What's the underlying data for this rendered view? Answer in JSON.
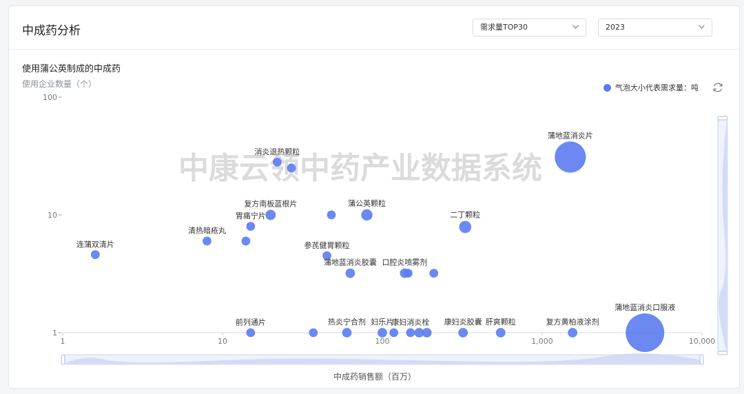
{
  "page": {
    "title": "中成药分析",
    "metric_select": "需求量TOP30",
    "year_select": "2023",
    "watermark": "中康云领中药产业数据系统"
  },
  "chart_data": {
    "type": "scatter",
    "title": "使用蒲公英制成的中成药",
    "xlabel": "中成药销售额（百万）",
    "ylabel": "使用企业数量（个）",
    "x_scale": "log",
    "y_scale": "log",
    "xlim": [
      1,
      10000
    ],
    "ylim": [
      1,
      100
    ],
    "x_ticks": [
      "1",
      "10",
      "100",
      "1,000",
      "10,000"
    ],
    "y_ticks": [
      "1",
      "10",
      "100"
    ],
    "legend": {
      "label": "气泡大小代表需求量：吨",
      "placement": "top-right"
    },
    "color": "#5b7cf0",
    "points": [
      {
        "x": 1.6,
        "y": 4.6,
        "size": 1,
        "label": "连蒲双清片"
      },
      {
        "x": 8,
        "y": 6,
        "size": 1,
        "label": "清热暗疮丸"
      },
      {
        "x": 14,
        "y": 6,
        "size": 1,
        "label": ""
      },
      {
        "x": 15,
        "y": 1,
        "size": 1,
        "label": "前列通片"
      },
      {
        "x": 15,
        "y": 8,
        "size": 1,
        "label": "胃痛宁片"
      },
      {
        "x": 20,
        "y": 10,
        "size": 2,
        "label": "复方南板蓝根片"
      },
      {
        "x": 22,
        "y": 28,
        "size": 1,
        "label": "消炎退热颗粒"
      },
      {
        "x": 27,
        "y": 25,
        "size": 1,
        "label": ""
      },
      {
        "x": 37,
        "y": 1,
        "size": 1,
        "label": ""
      },
      {
        "x": 45,
        "y": 4.5,
        "size": 1,
        "label": "参芪健胃颗粒"
      },
      {
        "x": 48,
        "y": 10,
        "size": 1,
        "label": ""
      },
      {
        "x": 60,
        "y": 1,
        "size": 1.5,
        "label": "热炎宁合剂"
      },
      {
        "x": 63,
        "y": 3.2,
        "size": 1.5,
        "label": "蒲地蓝消炎胶囊"
      },
      {
        "x": 80,
        "y": 10,
        "size": 3,
        "label": "蒲公英颗粒"
      },
      {
        "x": 100,
        "y": 1,
        "size": 1.5,
        "label": "妇乐片"
      },
      {
        "x": 118,
        "y": 1,
        "size": 1,
        "label": ""
      },
      {
        "x": 138,
        "y": 3.2,
        "size": 1.5,
        "label": "口腔炎喷雾剂"
      },
      {
        "x": 145,
        "y": 3.2,
        "size": 1,
        "label": ""
      },
      {
        "x": 150,
        "y": 1,
        "size": 1,
        "label": "康妇消炎栓"
      },
      {
        "x": 170,
        "y": 1,
        "size": 1.5,
        "label": ""
      },
      {
        "x": 190,
        "y": 1,
        "size": 1.5,
        "label": ""
      },
      {
        "x": 210,
        "y": 3.2,
        "size": 1,
        "label": ""
      },
      {
        "x": 330,
        "y": 7.9,
        "size": 4,
        "label": "二丁颗粒"
      },
      {
        "x": 320,
        "y": 1,
        "size": 1.5,
        "label": "康妇炎胶囊"
      },
      {
        "x": 550,
        "y": 1,
        "size": 1.5,
        "label": "肝爽颗粒"
      },
      {
        "x": 1550,
        "y": 1,
        "size": 1.5,
        "label": "复方黄柏液涂剂"
      },
      {
        "x": 1500,
        "y": 31,
        "size": 60,
        "label": "蒲地蓝消炎片"
      },
      {
        "x": 4400,
        "y": 1,
        "size": 100,
        "label": "蒲地蓝消炎口服液"
      }
    ]
  }
}
